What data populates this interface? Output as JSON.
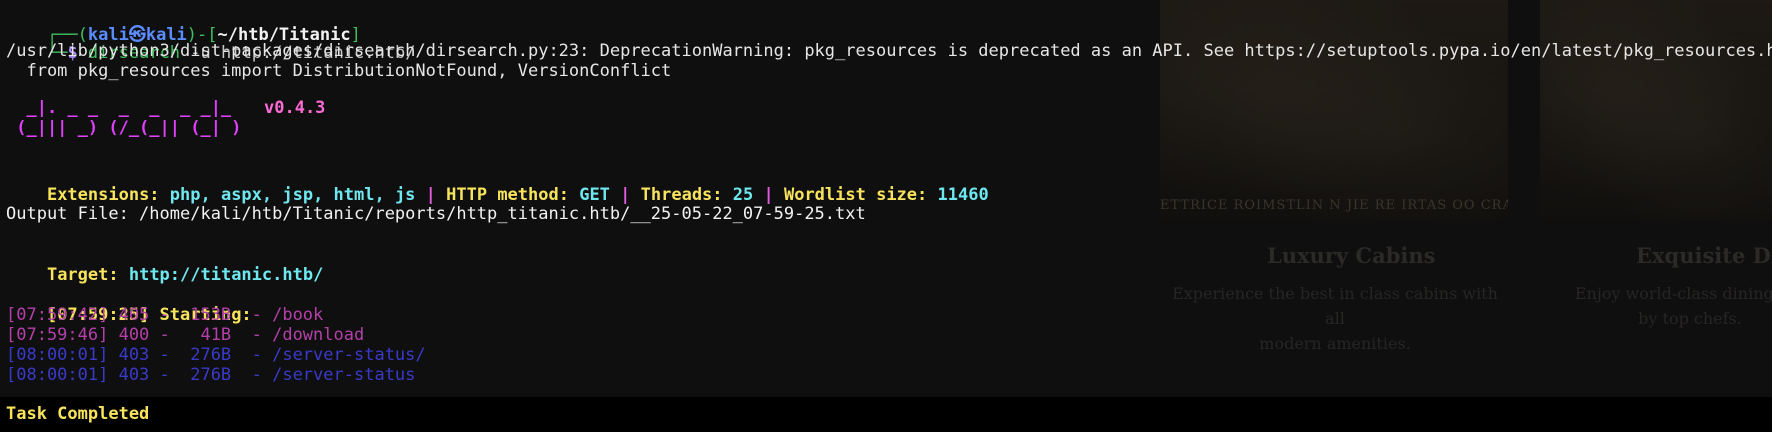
{
  "background_site": {
    "caption": "ETTRICE ROIMSTLIN N JIE RE IRTAS OO CRAST",
    "cards": [
      {
        "title": "Luxury Cabins",
        "desc_1": "Experience the best in class cabins with all",
        "desc_2": "modern amenities."
      },
      {
        "title": "Exquisite Dini",
        "desc_1": "Enjoy world-class dining opt",
        "desc_2": "by top chefs."
      }
    ]
  },
  "prompt": {
    "corner_top": "┌──(",
    "user": "kali㉿kali",
    "close_open": ")-[",
    "path": "~/htb/Titanic",
    "close": "]",
    "corner_bottom": "└─",
    "dollar": "$ ",
    "command": "dirsearch",
    "args": " -u http://titanic.htb/"
  },
  "warning": {
    "line1": "/usr/lib/python3/dist-packages/dirsearch/dirsearch.py:23: DeprecationWarning: pkg_resources is deprecated as an API. See https://setuptools.pypa.io/en/latest/pkg_resources.html",
    "line2": "  from pkg_resources import DistributionNotFound, VersionConflict"
  },
  "banner": {
    "art_line1": "  _|. _ _  _  _  _ _|_ ",
    "art_line2": " (_||| _) (/_(_|| (_| )",
    "version": "v0.4.3"
  },
  "config": {
    "ext_label": "Extensions: ",
    "ext_value": "php, aspx, jsp, html, js",
    "sep": " | ",
    "method_label": "HTTP method: ",
    "method_value": "GET",
    "threads_label": "Threads: ",
    "threads_value": "25",
    "wordlist_label": "Wordlist size: ",
    "wordlist_value": "11460"
  },
  "output_file": "Output File: /home/kali/htb/Titanic/reports/http_titanic.htb/__25-05-22_07-59-25.txt",
  "target": {
    "label": "Target: ",
    "url": "http://titanic.htb/"
  },
  "starting": {
    "time": "[07:59:25]",
    "label": " Starting:"
  },
  "results": [
    {
      "text": "[07:59:42] 405 -  153B  - /book",
      "color": "#b340a8"
    },
    {
      "text": "[07:59:46] 400 -   41B  - /download",
      "color": "#b340a8"
    },
    {
      "text": "[08:00:01] 403 -  276B  - /server-status/",
      "color": "#3a3ac8"
    },
    {
      "text": "[08:00:01] 403 -  276B  - /server-status",
      "color": "#3a3ac8"
    }
  ],
  "task_completed": "Task Completed"
}
